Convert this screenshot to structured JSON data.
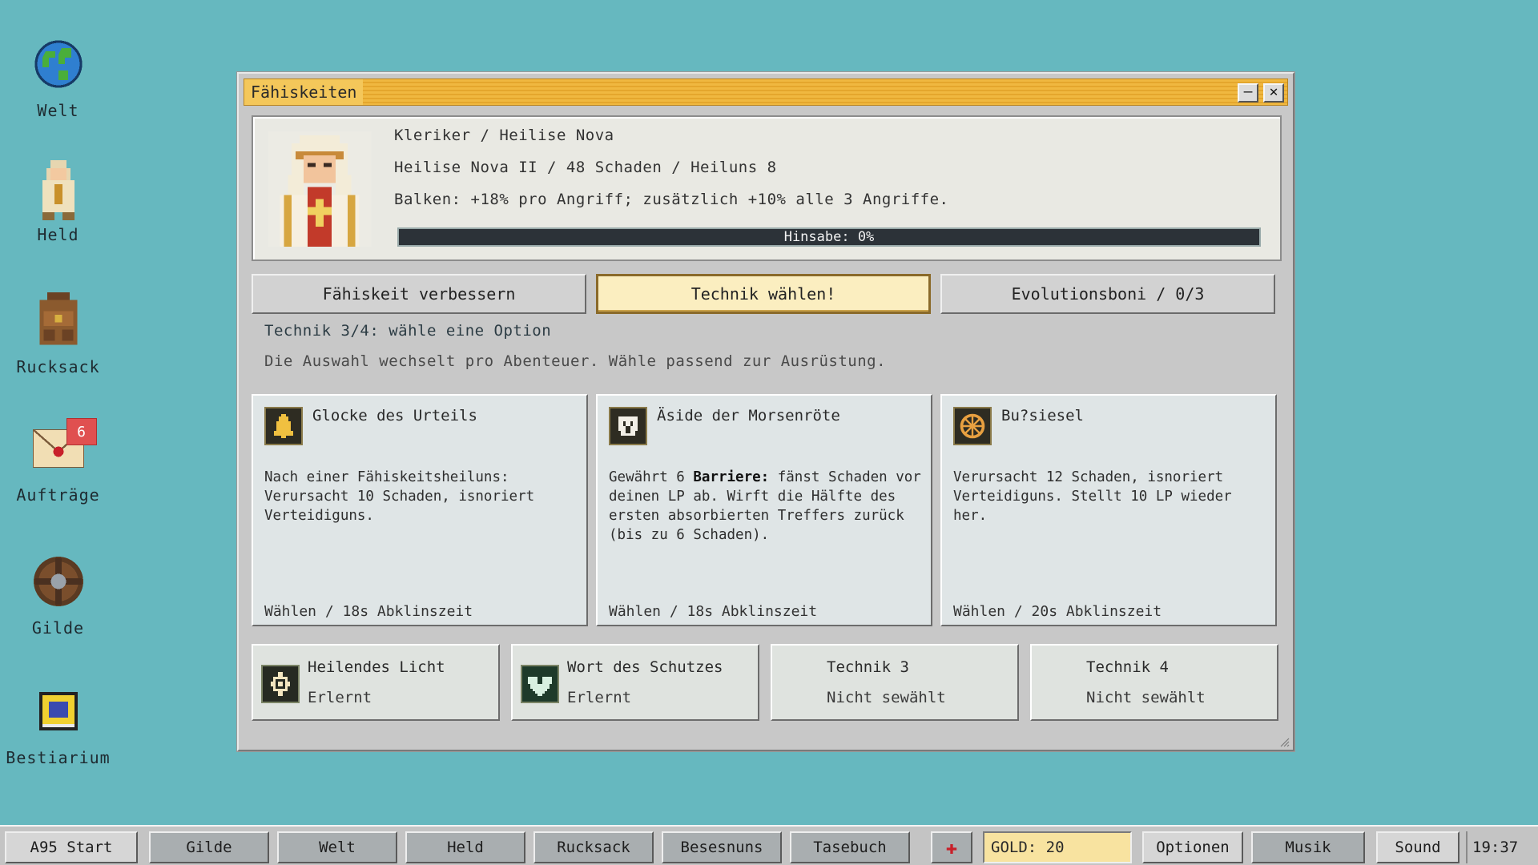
{
  "desktop": {
    "icons": [
      {
        "label": "Welt",
        "icon": "globe-icon"
      },
      {
        "label": "Held",
        "icon": "hero-icon"
      },
      {
        "label": "Rucksack",
        "icon": "backpack-icon"
      },
      {
        "label": "Aufträge",
        "icon": "envelope-icon",
        "badge": "6"
      },
      {
        "label": "Gilde",
        "icon": "shield-icon"
      },
      {
        "label": "Bestiarium",
        "icon": "bestiary-book-icon"
      }
    ]
  },
  "window": {
    "title": "Fähiskeiten",
    "minimize": "–",
    "close": "✕",
    "hero": {
      "line1": "Kleriker / Heilise Nova",
      "line2": "Heilise Nova II / 48 Schaden / Heiluns 8",
      "line3": "Balken: +18% pro Angriff; zusätzlich +10% alle 3 Angriffe.",
      "progress_label": "Hinsabe: 0%",
      "progress_value": 0
    },
    "tabs": [
      {
        "label": "Fähiskeit verbessern",
        "active": false
      },
      {
        "label": "Technik wählen!",
        "active": true
      },
      {
        "label": "Evolutionsboni / 0/3",
        "active": false
      }
    ],
    "instruction": "Technik 3/4: wähle eine Option",
    "hint": "Die Auswahl wechselt pro Abenteuer. Wähle passend zur Ausrüstung.",
    "options": [
      {
        "title": "Glocke des Urteils",
        "icon": "bell-icon",
        "desc_html": "Nach einer Fähiskeitsheiluns: Verursacht 10 Schaden, isnoriert Verteidiguns.",
        "footer": "Wählen / 18s Abklinszeit"
      },
      {
        "title": "Äside der Morsenröte",
        "icon": "aegis-icon",
        "desc_pre": "Gewährt 6 ",
        "desc_bold": "Barriere:",
        "desc_post": " fänst Schaden vor deinen LP ab. Wirft die Hälfte des ersten absorbierten Treffers zurück (bis zu 6 Schaden).",
        "footer": "Wählen / 18s Abklinszeit"
      },
      {
        "title": "Bu?siesel",
        "icon": "seal-icon",
        "desc_html": "Verursacht 12 Schaden, isnoriert Verteidiguns. Stellt 10 LP wieder her.",
        "footer": "Wählen / 20s Abklinszeit"
      }
    ],
    "slots": [
      {
        "name": "Heilendes Licht",
        "state": "Erlernt",
        "icon": "healing-light-icon"
      },
      {
        "name": "Wort des Schutzes",
        "state": "Erlernt",
        "icon": "heart-shield-icon"
      },
      {
        "name": "Technik 3",
        "state": "Nicht sewählt",
        "icon": ""
      },
      {
        "name": "Technik 4",
        "state": "Nicht sewählt",
        "icon": ""
      }
    ]
  },
  "taskbar": {
    "start": "A95 Start",
    "buttons": [
      "Gilde",
      "Welt",
      "Held",
      "Rucksack",
      "Besesnuns",
      "Tasebuch"
    ],
    "health_icon": "red-cross-icon",
    "gold": "GOLD: 20",
    "right_buttons": [
      "Optionen",
      "Musik",
      "Sound"
    ],
    "clock": "19:37"
  },
  "colors": {
    "desktop": "#66b8bf",
    "titlebar": "#f0b840",
    "active_tab": "#fbeec0",
    "gold_field": "#f8e3a0"
  }
}
